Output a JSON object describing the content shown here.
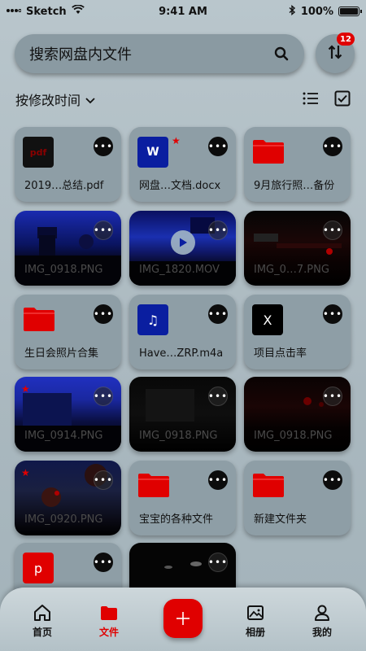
{
  "status_bar": {
    "carrier": "Sketch",
    "time": "9:41 AM",
    "battery": "100%"
  },
  "search": {
    "placeholder": "搜索网盘内文件"
  },
  "sort_button": {
    "badge_count": "12"
  },
  "toolbar": {
    "sort_label": "按修改时间"
  },
  "files": [
    {
      "name": "2019…总结.pdf",
      "kind": "pdf",
      "icon_text": "pdf"
    },
    {
      "name": "网盘…文档.docx",
      "kind": "doc",
      "icon_text": "W",
      "starred": true
    },
    {
      "name": "9月旅行照…备份",
      "kind": "folder"
    },
    {
      "name": "IMG_0918.PNG",
      "kind": "photo"
    },
    {
      "name": "IMG_1820.MOV",
      "kind": "video"
    },
    {
      "name": "IMG_0…7.PNG",
      "kind": "photo"
    },
    {
      "name": "生日会照片合集",
      "kind": "folder"
    },
    {
      "name": "Have…ZRP.m4a",
      "kind": "audio",
      "icon_text": "♫"
    },
    {
      "name": "项目点击率",
      "kind": "doc",
      "icon_text": "X"
    },
    {
      "name": "IMG_0914.PNG",
      "kind": "photo",
      "starred": true
    },
    {
      "name": "IMG_0918.PNG",
      "kind": "photo"
    },
    {
      "name": "IMG_0918.PNG",
      "kind": "photo"
    },
    {
      "name": "IMG_0920.PNG",
      "kind": "photo",
      "starred": true
    },
    {
      "name": "宝宝的各种文件",
      "kind": "folder"
    },
    {
      "name": "新建文件夹",
      "kind": "folder"
    },
    {
      "name": "",
      "kind": "ppt",
      "icon_text": "p"
    },
    {
      "name": "",
      "kind": "photo"
    }
  ],
  "tabs": [
    {
      "label": "首页",
      "icon": "home-icon"
    },
    {
      "label": "文件",
      "icon": "folder-icon",
      "active": true
    },
    {
      "label": "相册",
      "icon": "photo-icon"
    },
    {
      "label": "我的",
      "icon": "user-icon"
    }
  ],
  "colors": {
    "accent": "#e00000",
    "card": "#8e9ea6",
    "background": "#b9c6cc"
  }
}
